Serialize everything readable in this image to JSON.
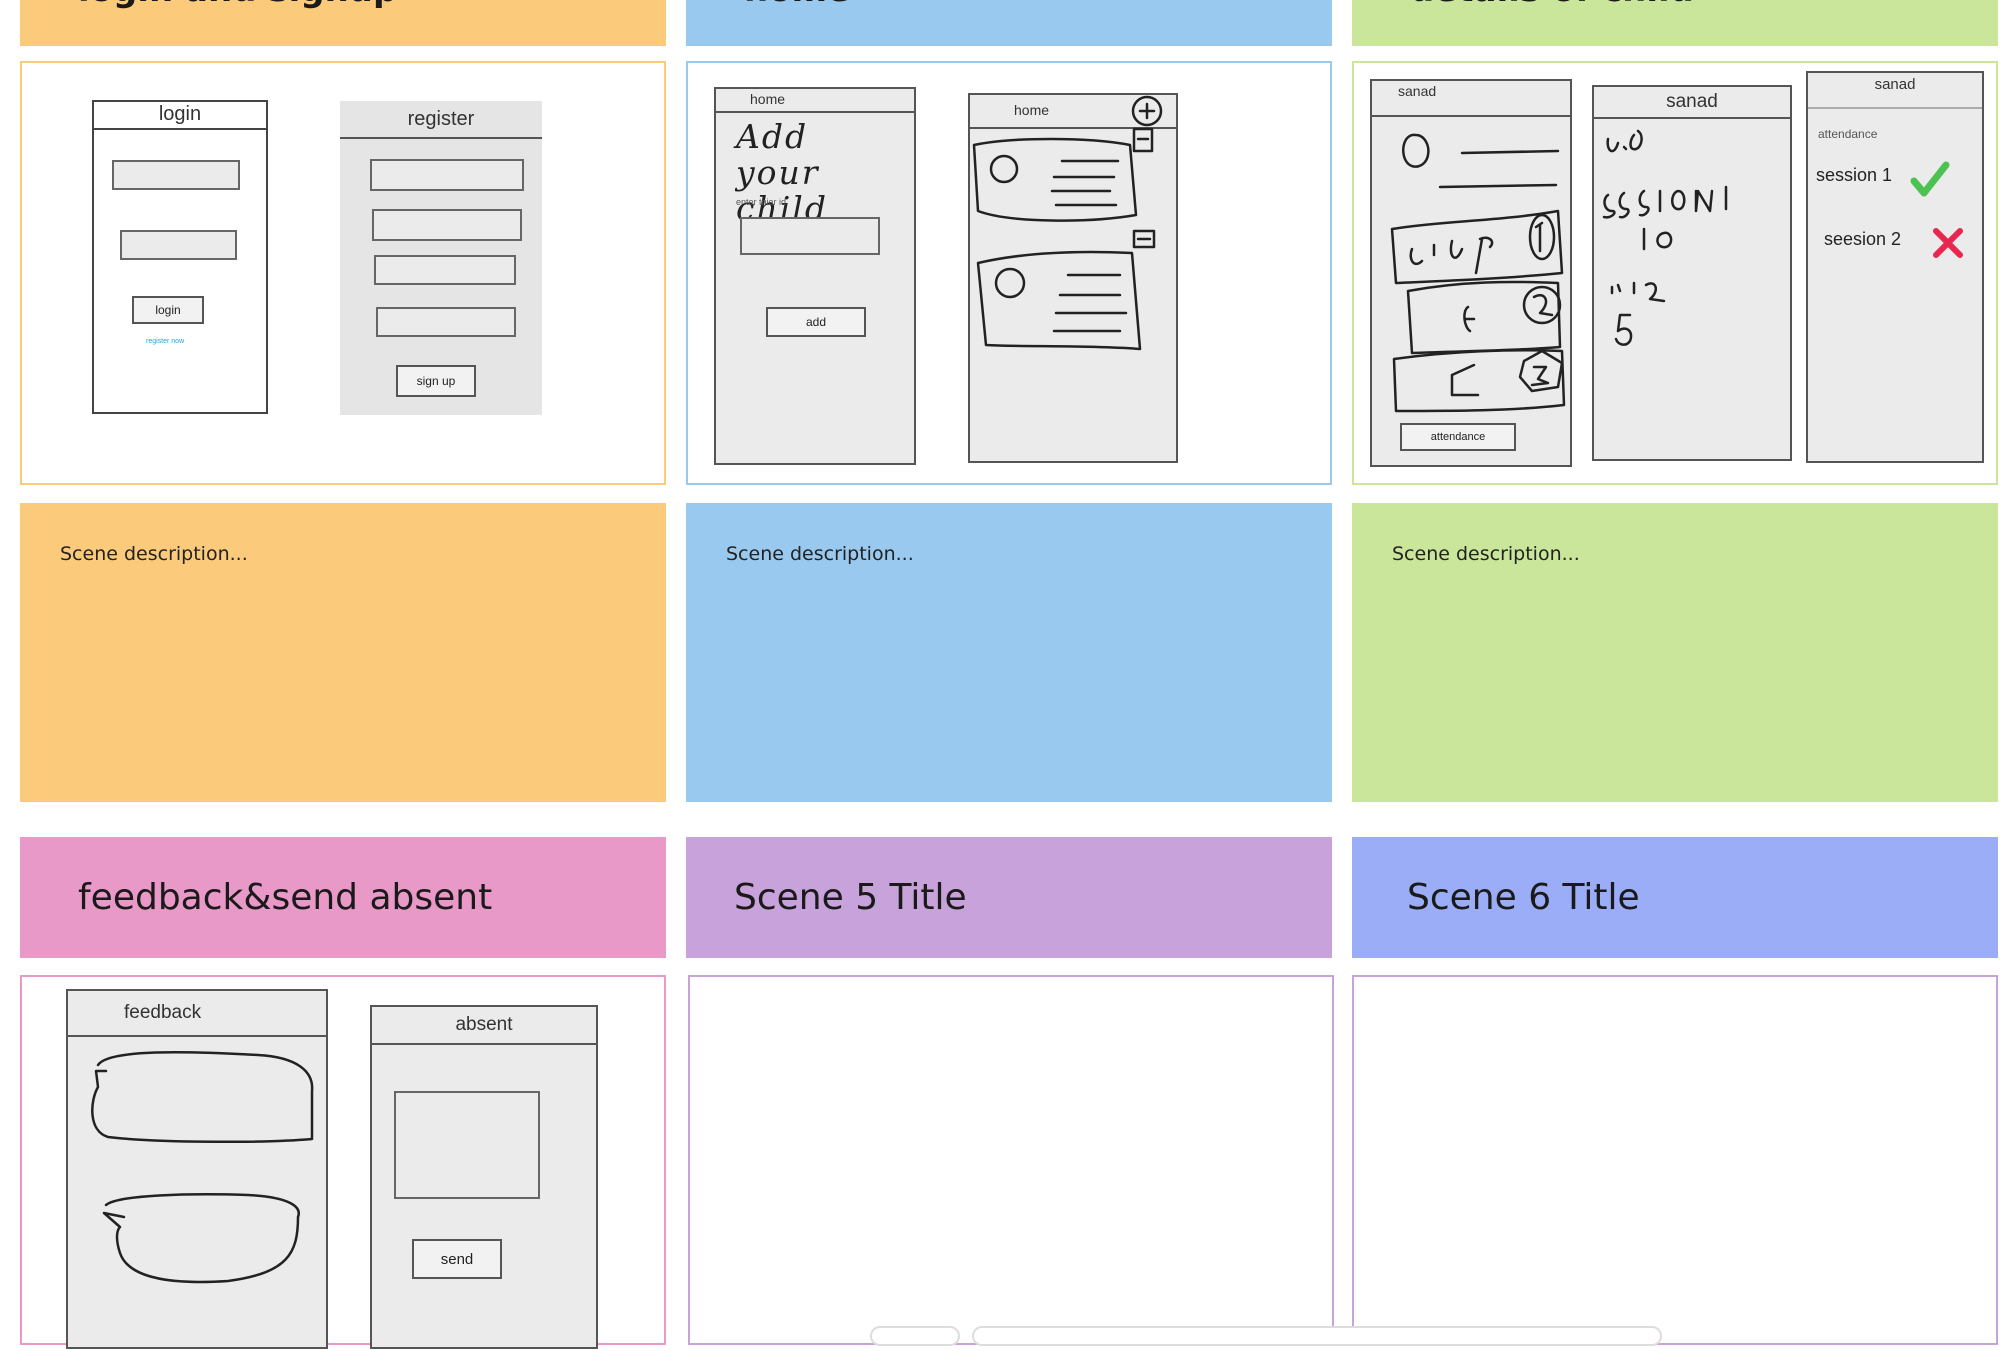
{
  "colors": {
    "orange": "#fbcb7b",
    "blue": "#99c9ef",
    "green": "#cae69b",
    "pink": "#e999c8",
    "purple": "#c8a2da",
    "periwinkle": "#9badf7"
  },
  "scenes": [
    {
      "title": "login and signup",
      "description": "Scene description...",
      "mockups": {
        "login": {
          "header": "login",
          "button": "login",
          "link": "register now"
        },
        "register": {
          "header": "register",
          "button": "sign up"
        }
      }
    },
    {
      "title": "home",
      "description": "Scene description...",
      "mockups": {
        "add_child": {
          "header": "home",
          "handwritten": "Add your child",
          "hint": "enter thier id",
          "button": "add"
        },
        "list": {
          "header": "home",
          "add_icon": "plus-circle-icon"
        }
      }
    },
    {
      "title": "details of child",
      "description": "Scene description...",
      "mockups": {
        "detail1": {
          "header": "sanad",
          "button": "attendance"
        },
        "detail2": {
          "header": "sanad"
        },
        "detail3": {
          "header": "sanad",
          "section": "attendance",
          "sessions": [
            {
              "label": "session 1",
              "status_icon": "check-icon",
              "status_color": "#4cc253"
            },
            {
              "label": "seesion 2",
              "status_icon": "cross-icon",
              "status_color": "#e8264f"
            }
          ]
        }
      }
    },
    {
      "title": "feedback&send absent",
      "mockups": {
        "feedback": {
          "header": "feedback"
        },
        "absent": {
          "header": "absent",
          "button": "send"
        }
      }
    },
    {
      "title": "Scene 5 Title"
    },
    {
      "title": "Scene 6 Title"
    }
  ]
}
